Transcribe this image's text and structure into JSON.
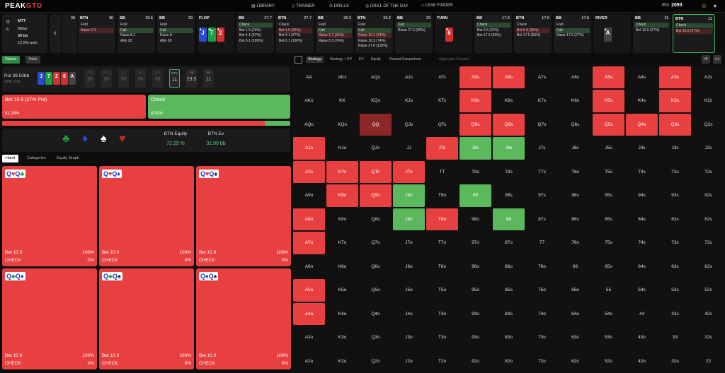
{
  "app": {
    "logo_a": "PEAK",
    "logo_b": "GTO"
  },
  "nav": [
    "LIBRARY",
    "TRAINER",
    "DRILLS",
    "DRILL OF THE DAY",
    "LEAK FINDER"
  ],
  "elo": {
    "label": "Elo",
    "value": "2093"
  },
  "info": {
    "format": "MTT",
    "players": "8Max",
    "stack": "30 bb",
    "ante": "12.5% ante"
  },
  "actions": [
    {
      "pos": "",
      "stack": "30",
      "opts": []
    },
    {
      "pos": "BTN",
      "stack": "30",
      "opts": [
        {
          "t": "Fold"
        },
        {
          "t": "Raise 2.3",
          "s": "hit"
        }
      ]
    },
    {
      "pos": "SB",
      "stack": "29.5",
      "opts": [
        {
          "t": "Fold"
        },
        {
          "t": "Call",
          "s": "sel"
        },
        {
          "t": "Raise 8.1"
        },
        {
          "t": "Allin 30"
        }
      ]
    },
    {
      "pos": "BB",
      "stack": "29",
      "opts": [
        {
          "t": "Fold"
        },
        {
          "t": "Call",
          "s": "sel"
        },
        {
          "t": "Raise 8"
        },
        {
          "t": "Allin 30"
        }
      ]
    },
    {
      "pos": "FLOP",
      "stack": "",
      "board": true
    },
    {
      "pos": "BB",
      "stack": "27.7",
      "opts": [
        {
          "t": "Check",
          "s": "sel"
        },
        {
          "t": "Bet 1.5 (24%)"
        },
        {
          "t": "Bet 4.1 (67%)"
        },
        {
          "t": "Bet 6.1 (100%)"
        }
      ]
    },
    {
      "pos": "BTN",
      "stack": "27.7",
      "opts": [
        {
          "t": "Check"
        },
        {
          "t": "Bet 1.5 (24%)",
          "s": "hit"
        },
        {
          "t": "Bet 4.1 (67%)"
        },
        {
          "t": "Bet 6.1 (100%)"
        }
      ]
    },
    {
      "pos": "BB",
      "stack": "26.2",
      "opts": [
        {
          "t": "Fold"
        },
        {
          "t": "Call",
          "s": "sel"
        },
        {
          "t": "Raise 4.7 (35%)",
          "s": "hit"
        },
        {
          "t": "Raise 8.3 (74%)"
        }
      ]
    },
    {
      "pos": "BTN",
      "stack": "26.2",
      "opts": [
        {
          "t": "Fold"
        },
        {
          "t": "Call",
          "s": "sel"
        },
        {
          "t": "Raise 10.1 (24%)",
          "s": "hit"
        },
        {
          "t": "Raise 16.3 (74%)"
        },
        {
          "t": "Raise 27.6 (100%)"
        }
      ]
    },
    {
      "pos": "BB",
      "stack": "23",
      "opts": [
        {
          "t": "Call",
          "s": "sel"
        },
        {
          "t": "Raise 27.6 (66%)"
        }
      ]
    },
    {
      "pos": "TURN",
      "stack": "",
      "turn": true
    },
    {
      "pos": "BB",
      "stack": "17.6",
      "opts": [
        {
          "t": "Check",
          "s": "sel"
        },
        {
          "t": "Bet 6.6 (25%)"
        },
        {
          "t": "Bet 17.5 (66%)"
        }
      ]
    },
    {
      "pos": "BTN",
      "stack": "17.6",
      "opts": [
        {
          "t": "Check"
        },
        {
          "t": "Bet 6.6 (25%)",
          "s": "hit"
        },
        {
          "t": "Bet 17.5 (66%)"
        }
      ]
    },
    {
      "pos": "BB",
      "stack": "17.6",
      "opts": [
        {
          "t": "Fold"
        },
        {
          "t": "Call",
          "s": "sel"
        },
        {
          "t": "Raise 17.5 (27%)"
        }
      ]
    },
    {
      "pos": "RIVER",
      "stack": "",
      "river": true
    },
    {
      "pos": "BB",
      "stack": "11",
      "opts": [
        {
          "t": "Check",
          "s": "sel"
        },
        {
          "t": "Bet 10.9 (27%)"
        }
      ]
    },
    {
      "pos": "BTN",
      "stack": "11",
      "cur": true,
      "opts": [
        {
          "t": "Check",
          "s": "sel"
        },
        {
          "t": "Bet 10.9 (27%)",
          "s": "hit"
        }
      ]
    }
  ],
  "flop": [
    {
      "r": "J",
      "s": "♦",
      "c": "#2a4bd6"
    },
    {
      "r": "7",
      "s": "♣",
      "c": "#1c9e3f"
    },
    {
      "r": "2",
      "s": "♥",
      "c": "#d32f2f"
    }
  ],
  "turn": {
    "r": "6",
    "s": "♥",
    "c": "#d32f2f"
  },
  "river": {
    "r": "A",
    "s": "♠",
    "c": "#444"
  },
  "stacks_btns": [
    "Stacks",
    "Table"
  ],
  "pot": {
    "label": "Pot",
    "value": "39.50bb",
    "spr": "SPR: 0.00"
  },
  "board_mini": [
    {
      "r": "J",
      "c": "#2a4bd6"
    },
    {
      "r": "7",
      "c": "#1c9e3f"
    },
    {
      "r": "2",
      "c": "#d32f2f"
    },
    {
      "r": "6",
      "c": "#d32f2f"
    },
    {
      "r": "A",
      "c": "#444"
    }
  ],
  "seats": [
    {
      "p": "UTG",
      "s": "30"
    },
    {
      "p": "UTG+1",
      "s": "30"
    },
    {
      "p": "LJ",
      "s": "30"
    },
    {
      "p": "HJ",
      "s": "30"
    },
    {
      "p": "CO",
      "s": "30"
    },
    {
      "p": "BTN",
      "s": "11",
      "cur": true
    },
    {
      "p": "SB",
      "s": "29.5",
      "done": true
    },
    {
      "p": "BB",
      "s": "11",
      "done": true
    }
  ],
  "actions_main": {
    "bet_label": "Bet 10.9 (27% Pot)",
    "bet_pct": "91.18%",
    "check_label": "Check",
    "check_pct": "8.82%",
    "bet_fraction": 0.9118
  },
  "equity": {
    "eq_label": "BTN Equity",
    "eq_value": "72.25 %",
    "ev_label": "BTN Ev",
    "ev_value": "31.90 bb"
  },
  "hand_tabs": [
    "Hand",
    "Categories",
    "Equity Graph"
  ],
  "combos": [
    {
      "c1": "♥",
      "c1c": "rs",
      "c2": "♣",
      "c2c": "gs",
      "bet": "Bet 10.9",
      "betv": "100%",
      "chk": "CHECK",
      "chkv": "0%"
    },
    {
      "c1": "♥",
      "c1c": "rs",
      "c2": "♦",
      "c2c": "bs",
      "bet": "Bet 10.9",
      "betv": "100%",
      "chk": "CHECK",
      "chkv": "0%"
    },
    {
      "c1": "♥",
      "c1c": "rs",
      "c2": "♠",
      "c2c": "ks",
      "bet": "Bet 10.9",
      "betv": "100%",
      "chk": "CHECK",
      "chkv": "0%"
    },
    {
      "c1": "♣",
      "c1c": "gs",
      "c2": "♦",
      "c2c": "bs",
      "bet": "Bet 10.9",
      "betv": "100%",
      "chk": "CHECK",
      "chkv": "0%"
    },
    {
      "c1": "♣",
      "c1c": "gs",
      "c2": "♠",
      "c2c": "ks",
      "bet": "Bet 10.9",
      "betv": "100%",
      "chk": "CHECK",
      "chkv": "0%"
    },
    {
      "c1": "♦",
      "c1c": "bs",
      "c2": "♠",
      "c2c": "ks",
      "bet": "Bet 10.9",
      "betv": "100%",
      "chk": "CHECK",
      "chkv": "0%"
    }
  ],
  "right_tabs": [
    "Strategy",
    "Strategy + EV",
    "EV",
    "Equity",
    "Runout Comparison",
    "Aggregate Reports"
  ],
  "grid": [
    [
      "AA",
      "AKs",
      "AQs",
      "AJs",
      "ATs",
      "A9s",
      "A8s",
      "A7s",
      "A6s",
      "A5s",
      "A4s",
      "A3s",
      "A2s"
    ],
    [
      "AKo",
      "KK",
      "KQs",
      "KJs",
      "KTs",
      "K9s",
      "K8s",
      "K7s",
      "K6s",
      "K5s",
      "K4s",
      "K3s",
      "K2s"
    ],
    [
      "AQo",
      "KQo",
      "QQ",
      "QJs",
      "QTs",
      "Q9s",
      "Q8s",
      "Q7s",
      "Q6s",
      "Q5s",
      "Q4s",
      "Q3s",
      "Q2s"
    ],
    [
      "AJo",
      "KJo",
      "QJo",
      "JJ",
      "JTs",
      "J9s",
      "J8s",
      "J7s",
      "J6s",
      "J5s",
      "J4s",
      "J3s",
      "J2s"
    ],
    [
      "ATo",
      "KTo",
      "QTo",
      "JTo",
      "TT",
      "T9s",
      "T8s",
      "T7s",
      "T6s",
      "T5s",
      "T4s",
      "T3s",
      "T2s"
    ],
    [
      "A9o",
      "K9o",
      "Q9o",
      "J9o",
      "T9o",
      "99",
      "98s",
      "97s",
      "96s",
      "95s",
      "94s",
      "93s",
      "92s"
    ],
    [
      "A8o",
      "K8o",
      "Q8o",
      "J8o",
      "T8o",
      "98o",
      "88",
      "87s",
      "86s",
      "85s",
      "84s",
      "83s",
      "82s"
    ],
    [
      "A7o",
      "K7o",
      "Q7o",
      "J7o",
      "T7o",
      "97o",
      "87o",
      "77",
      "76s",
      "75s",
      "74s",
      "73s",
      "72s"
    ],
    [
      "A6o",
      "K6o",
      "Q6o",
      "J6o",
      "T6o",
      "96o",
      "86o",
      "76o",
      "66",
      "65s",
      "64s",
      "63s",
      "62s"
    ],
    [
      "A5o",
      "K5o",
      "Q5o",
      "J5o",
      "T5o",
      "95o",
      "85o",
      "75o",
      "65o",
      "55",
      "54s",
      "53s",
      "52s"
    ],
    [
      "A4o",
      "K4o",
      "Q4o",
      "J4o",
      "T4o",
      "94o",
      "84o",
      "74o",
      "64o",
      "54o",
      "44",
      "43s",
      "42s"
    ],
    [
      "A3o",
      "K3o",
      "Q3o",
      "J3o",
      "T3o",
      "93o",
      "83o",
      "73o",
      "63o",
      "53o",
      "43o",
      "33",
      "32s"
    ],
    [
      "A2o",
      "K2o",
      "Q2o",
      "J2o",
      "T2o",
      "92o",
      "82o",
      "72o",
      "62o",
      "52o",
      "42o",
      "32o",
      "22"
    ]
  ],
  "grid_colors": [
    "",
    "",
    "",
    "",
    "",
    "b",
    "b",
    "",
    "",
    "b",
    "",
    "b",
    "",
    "",
    "",
    "",
    "",
    "",
    "b",
    "",
    "",
    "",
    "b",
    "",
    "b",
    "",
    "",
    "",
    "m",
    "",
    "",
    "b",
    "b",
    "",
    "",
    "b",
    "b",
    "b",
    "",
    "b",
    "",
    "",
    "",
    "b",
    "c",
    "c",
    "",
    "",
    "",
    "",
    "",
    "",
    "b",
    "b",
    "b",
    "b",
    "",
    "",
    "",
    "",
    "",
    "",
    "",
    "",
    "",
    "",
    "b",
    "b",
    "c",
    "",
    "c",
    "",
    "",
    "",
    "",
    "",
    "",
    "",
    "b",
    "",
    "",
    "c",
    "b",
    "",
    "c",
    "",
    "",
    "",
    "",
    "",
    "",
    "b",
    "",
    "",
    "",
    "",
    "",
    "",
    "",
    "",
    "",
    "",
    "",
    "",
    "",
    "",
    "",
    "",
    "",
    "",
    "",
    "",
    "",
    "",
    "",
    "",
    "",
    "b",
    "",
    "",
    "",
    "",
    "",
    "",
    "",
    "",
    "",
    "",
    "",
    "",
    "b",
    "",
    "",
    "",
    "",
    "",
    "",
    "",
    "",
    "",
    "",
    "",
    "",
    "",
    "",
    "",
    "",
    "",
    "",
    "",
    "",
    "",
    "",
    "",
    "",
    "",
    "",
    "",
    "",
    "",
    "",
    "",
    "",
    "",
    "",
    "",
    "",
    "",
    ""
  ]
}
